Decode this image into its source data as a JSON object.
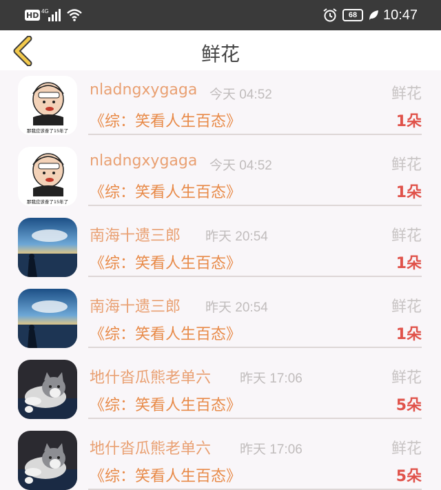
{
  "status_bar": {
    "hd_label": "HD",
    "network_label": "4G",
    "battery_level": "68",
    "time": "10:47",
    "icons": [
      "signal-icon",
      "wifi-icon",
      "alarm-icon",
      "battery-icon",
      "leaf-icon"
    ]
  },
  "nav": {
    "back_icon": "chevron-left-icon",
    "title": "鲜花"
  },
  "records": [
    {
      "name": "nladngxygaga",
      "time": "今天 04:52",
      "gift": "鲜花",
      "story": "《综：笑看人生百态》",
      "count": "1朵",
      "avatar": "cartoon-meme",
      "avatar_caption": "那我应该奋了15年了"
    },
    {
      "name": "nladngxygaga",
      "time": "今天 04:52",
      "gift": "鲜花",
      "story": "《综：笑看人生百态》",
      "count": "1朵",
      "avatar": "cartoon-meme",
      "avatar_caption": "那我应该奋了15年了"
    },
    {
      "name": "南海十遗三郎",
      "time": "昨天 20:54",
      "gift": "鲜花",
      "story": "《综：笑看人生百态》",
      "count": "1朵",
      "avatar": "sea-sunset"
    },
    {
      "name": "南海十遗三郎",
      "time": "昨天 20:54",
      "gift": "鲜花",
      "story": "《综：笑看人生百态》",
      "count": "1朵",
      "avatar": "sea-sunset"
    },
    {
      "name": "地什沓瓜熊老单六",
      "time": "昨天 17:06",
      "gift": "鲜花",
      "story": "《综：笑看人生百态》",
      "count": "5朵",
      "avatar": "cat-photo"
    },
    {
      "name": "地什沓瓜熊老单六",
      "time": "昨天 17:06",
      "gift": "鲜花",
      "story": "《综：笑看人生百态》",
      "count": "5朵",
      "avatar": "cat-photo"
    }
  ],
  "colors": {
    "status_bar_bg": "#3a3a3a",
    "back_icon": "#f2c94c",
    "name": "#e9a072",
    "story": "#e88a48",
    "count": "#e0524a",
    "muted": "#c0bcbc"
  }
}
